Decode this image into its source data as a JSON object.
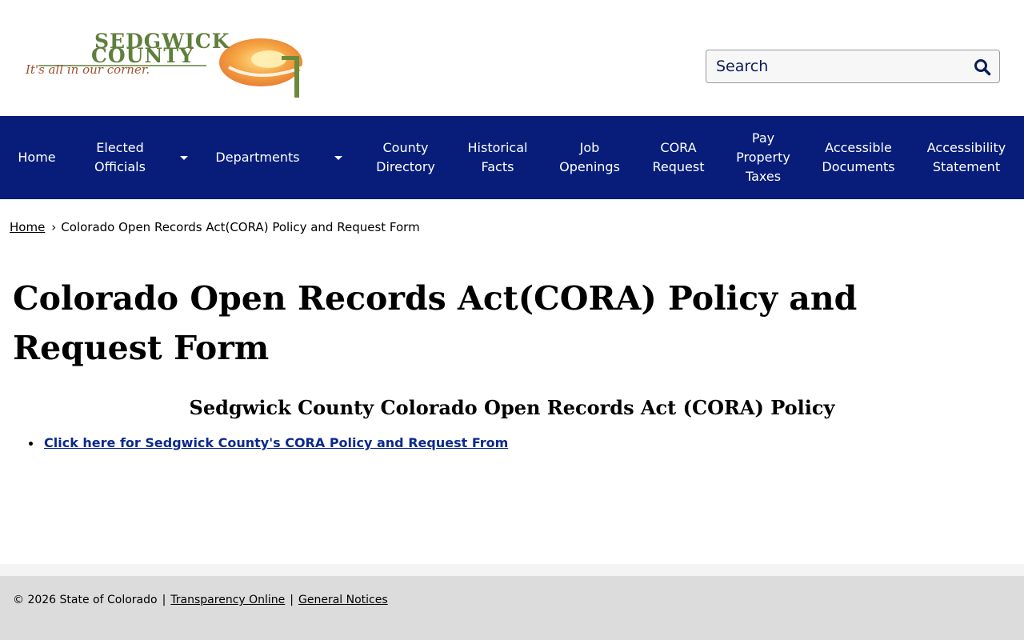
{
  "header": {
    "logo": {
      "name": "SEDGWICK",
      "name2": "COUNTY",
      "tagline": "It's all in our corner."
    },
    "search": {
      "placeholder": "Search"
    }
  },
  "nav": {
    "items": [
      {
        "label": "Home"
      },
      {
        "label": "Elected Officials",
        "has_submenu": true
      },
      {
        "label": "Departments",
        "has_submenu": true
      },
      {
        "label": "County Directory"
      },
      {
        "label": "Historical Facts"
      },
      {
        "label": "Job Openings"
      },
      {
        "label": "CORA Request"
      },
      {
        "label": "Pay Property Taxes"
      },
      {
        "label": "Accessible Documents"
      },
      {
        "label": "Accessibility Statement"
      }
    ]
  },
  "breadcrumb": {
    "home": "Home",
    "separator": "›",
    "current": "Colorado Open Records Act(CORA) Policy and Request Form"
  },
  "main": {
    "title": "Colorado Open Records Act(CORA) Policy and Request Form",
    "section_heading": "Sedgwick County Colorado Open Records Act (CORA) Policy",
    "links": [
      {
        "label": "Click here for Sedgwick County's CORA Policy and Request From"
      }
    ]
  },
  "footer": {
    "copyright": "© 2026 State of Colorado",
    "separator": "|",
    "links": [
      {
        "label": "Transparency Online"
      },
      {
        "label": "General Notices"
      }
    ]
  },
  "colors": {
    "nav_background": "#071d79",
    "link": "#0b2a8a",
    "footer_background": "#dcdcdc",
    "logo_green": "#5f7f3d",
    "logo_orange": "#ee8a2a"
  }
}
